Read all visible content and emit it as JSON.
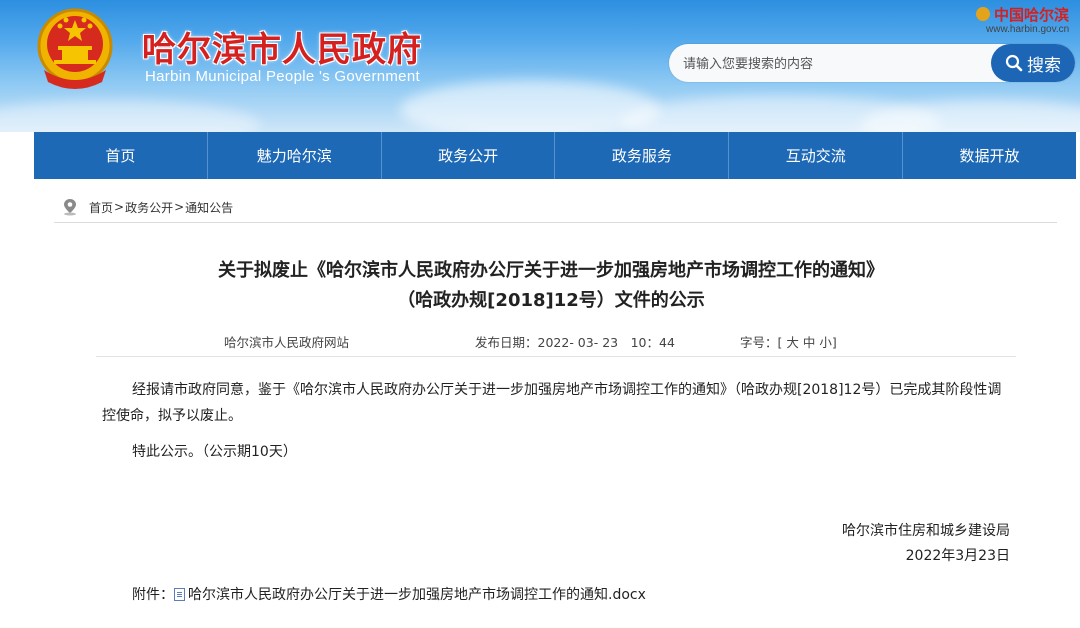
{
  "header": {
    "site_title": "哈尔滨市人民政府",
    "site_subtitle": "Harbin Municipal People 's Government",
    "gov_logo_text": "中国哈尔滨",
    "gov_url": "www.harbin.gov.cn",
    "search": {
      "placeholder": "请输入您要搜索的内容",
      "button_label": "搜索"
    }
  },
  "nav": {
    "items": [
      "首页",
      "魅力哈尔滨",
      "政务公开",
      "政务服务",
      "互动交流",
      "数据开放"
    ]
  },
  "breadcrumb": [
    "首页",
    "政务公开",
    "通知公告"
  ],
  "article": {
    "title_line1": "关于拟废止《哈尔滨市人民政府办公厅关于进一步加强房地产市场调控工作的通知》",
    "title_line2": "（哈政办规[2018]12号）文件的公示",
    "source": "哈尔滨市人民政府网站",
    "date_label": "发布日期：",
    "date_value": "2022- 03- 23　10：44",
    "fontsize_label": "字号：[",
    "fontsize_options": [
      "大",
      "中",
      "小"
    ],
    "fontsize_end": "]",
    "paragraph1": "经报请市政府同意，鉴于《哈尔滨市人民政府办公厅关于进一步加强房地产市场调控工作的通知》（哈政办规[2018]12号）已完成其阶段性调控使命，拟予以废止。",
    "paragraph2": "特此公示。（公示期10天）",
    "sign_org": "哈尔滨市住房和城乡建设局",
    "sign_date": "2022年3月23日",
    "attachment_label": "附件：",
    "attachment_name": "哈尔滨市人民政府办公厅关于进一步加强房地产市场调控工作的通知.docx"
  },
  "colors": {
    "nav_bg": "#1e69b6",
    "title_red": "#d52020",
    "search_btn": "#1d66b5"
  },
  "icons": [
    "national-emblem-icon",
    "search-icon",
    "location-pin-icon",
    "doc-file-icon",
    "gov-logo-icon"
  ]
}
